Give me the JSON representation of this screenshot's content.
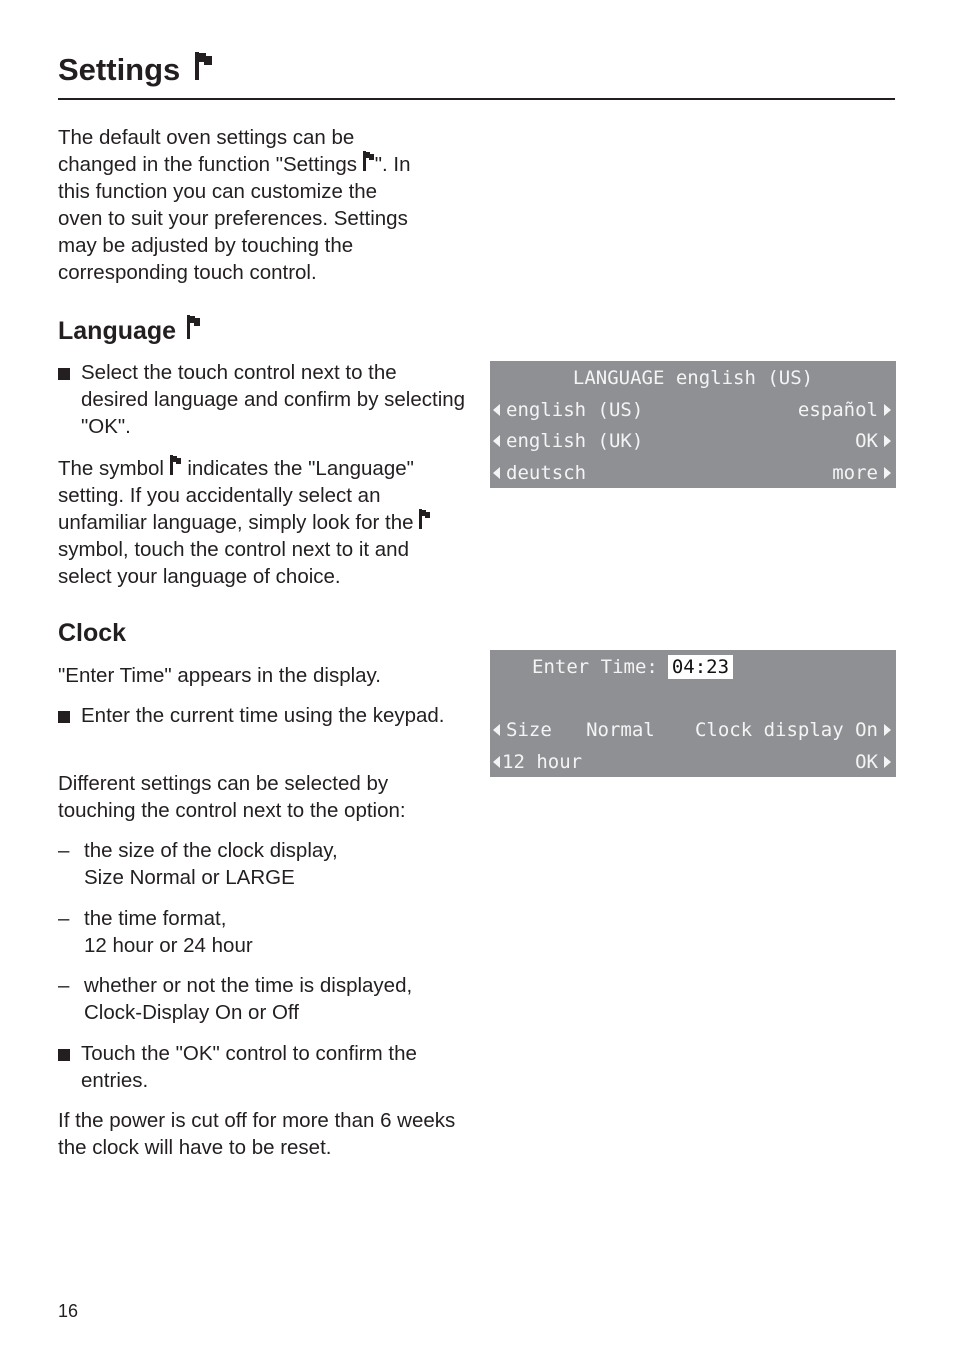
{
  "page": {
    "title": "Settings",
    "title_icon": "flag-icon",
    "page_number": "16"
  },
  "intro": {
    "lines": [
      "The default oven settings can be",
      "changed in the function \"Settings ",
      "\". In",
      "this function you can customize the",
      "oven to suit your preferences. Settings",
      "may be adjusted by touching the",
      "corresponding touch control."
    ]
  },
  "language": {
    "heading": "Language",
    "heading_icon": "flag-icon",
    "bullet": "Select the touch control next to the desired language and confirm by selecting \"OK\".",
    "para_before_icon": "The symbol ",
    "para_mid": " indicates the \"Language\" setting. If you accidentally select an unfamiliar language, simply look for the ",
    "para_after_icon": " symbol, touch the control next to it and select your language of choice.",
    "display": {
      "title": "LANGUAGE english (US)",
      "rows": [
        {
          "left": "english (US)",
          "right": "español"
        },
        {
          "left": "english (UK)",
          "right": "OK"
        },
        {
          "left": "deutsch",
          "right": "more"
        }
      ]
    }
  },
  "clock": {
    "heading": "Clock",
    "intro": "\"Enter Time\" appears in the display.",
    "bullet1": "Enter the current time using the keypad.",
    "para1": "Different settings can be selected by touching the control next to the option:",
    "dash_symbol": "–",
    "options": [
      {
        "line1": "the size of the clock display,",
        "line2": "Size Normal or LARGE"
      },
      {
        "line1": "the time format,",
        "line2": "12 hour or 24 hour"
      },
      {
        "line1": "whether or not the time is displayed,",
        "line2": "Clock-Display On or Off"
      }
    ],
    "bullet2": "Touch the \"OK\" control to confirm the entries.",
    "para2": "If the power is cut off for more than 6 weeks the clock will have to be reset.",
    "display": {
      "enter_time_label": "Enter Time:",
      "time_value": "04:23",
      "rows": [
        {
          "left": "Size   Normal",
          "right": "Clock display On"
        },
        {
          "left": "12 hour",
          "right": "OK"
        }
      ]
    }
  },
  "colors": {
    "text": "#231f20",
    "display_bg": "#8f9094",
    "display_text": "#f4f4f4"
  }
}
